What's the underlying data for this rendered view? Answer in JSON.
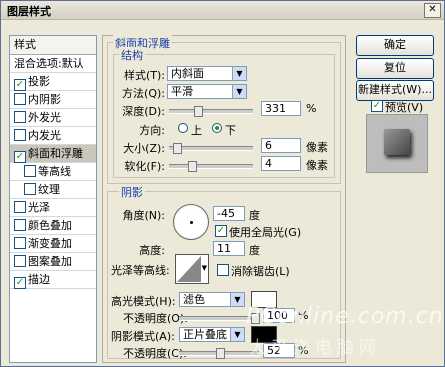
{
  "window": {
    "title": "图层样式",
    "close_glyph": "✕"
  },
  "style_list": {
    "header": "样式",
    "items": [
      {
        "label": "混合选项:默认",
        "checked": false,
        "has_check": false
      },
      {
        "label": "投影",
        "checked": true,
        "has_check": true
      },
      {
        "label": "内阴影",
        "checked": false,
        "has_check": true
      },
      {
        "label": "外发光",
        "checked": false,
        "has_check": true
      },
      {
        "label": "内发光",
        "checked": false,
        "has_check": true
      },
      {
        "label": "斜面和浮雕",
        "checked": true,
        "has_check": true,
        "selected": true
      },
      {
        "label": "等高线",
        "checked": false,
        "has_check": true,
        "sub": true
      },
      {
        "label": "纹理",
        "checked": false,
        "has_check": true,
        "sub": true
      },
      {
        "label": "光泽",
        "checked": false,
        "has_check": true
      },
      {
        "label": "颜色叠加",
        "checked": false,
        "has_check": true
      },
      {
        "label": "渐变叠加",
        "checked": false,
        "has_check": true
      },
      {
        "label": "图案叠加",
        "checked": false,
        "has_check": true
      },
      {
        "label": "描边",
        "checked": true,
        "has_check": true
      }
    ]
  },
  "bevel": {
    "group_title": "斜面和浮雕",
    "structure_title": "结构",
    "style_label": "样式(T):",
    "style_value": "内斜面",
    "technique_label": "方法(Q):",
    "technique_value": "平滑",
    "depth_label": "深度(D):",
    "depth_value": "331",
    "depth_unit": "%",
    "depth_level": 0.33,
    "direction_label": "方向:",
    "dir_up": "上",
    "dir_down": "下",
    "direction": "down",
    "size_label": "大小(Z):",
    "size_value": "6",
    "size_unit": "像素",
    "size_level": 0.05,
    "soften_label": "软化(F):",
    "soften_value": "4",
    "soften_unit": "像素",
    "soften_level": 0.25
  },
  "shading": {
    "group_title": "阴影",
    "angle_label": "角度(N):",
    "angle_value": "-45",
    "angle_unit": "度",
    "global_light_label": "使用全局光(G)",
    "global_light": true,
    "altitude_label": "高度:",
    "altitude_value": "11",
    "altitude_unit": "度",
    "gloss_label": "光泽等高线:",
    "antialias_label": "消除锯齿(L)",
    "antialias": false,
    "highlight_mode_label": "高光模式(H):",
    "highlight_mode": "滤色",
    "highlight_color": "#ffffff",
    "highlight_opacity_label": "不透明度(O):",
    "highlight_opacity": "100",
    "opacity_unit": "%",
    "highlight_opacity_level": 1.0,
    "shadow_mode_label": "阴影模式(A):",
    "shadow_mode": "正片叠底",
    "shadow_color": "#000000",
    "shadow_opacity_label": "不透明度(C):",
    "shadow_opacity": "52",
    "shadow_opacity_level": 0.52
  },
  "buttons": {
    "ok": "确定",
    "reset": "复位",
    "new_style": "新建样式(W)...",
    "preview_label": "预览(V)",
    "preview": true
  },
  "watermark": {
    "line1": "PConline.com.cn",
    "line2": "太平洋电脑网"
  }
}
